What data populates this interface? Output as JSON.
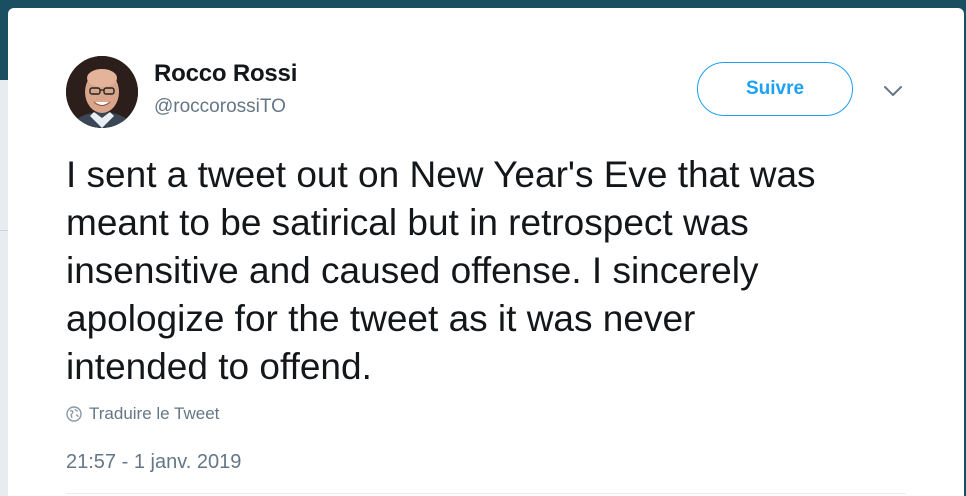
{
  "author": {
    "name": "Rocco Rossi",
    "handle": "@roccorossiTO"
  },
  "follow_button": {
    "label": "Suivre"
  },
  "menu": {
    "icon": "chevron-down-icon"
  },
  "tweet": {
    "text": "I sent a tweet out on New Year's Eve that was\nmeant to be satirical but in retrospect was\ninsensitive and caused offense.  I sincerely\napologize for the tweet as it was never\nintended to offend.",
    "translate_label": "Traduire le Tweet",
    "translate_icon": "globe-icon",
    "timestamp": "21:57 - 1 janv. 2019"
  },
  "colors": {
    "accent": "#1da1f2",
    "text_primary": "#14171a",
    "text_secondary": "#657786",
    "page_background": "#1a4f62"
  }
}
